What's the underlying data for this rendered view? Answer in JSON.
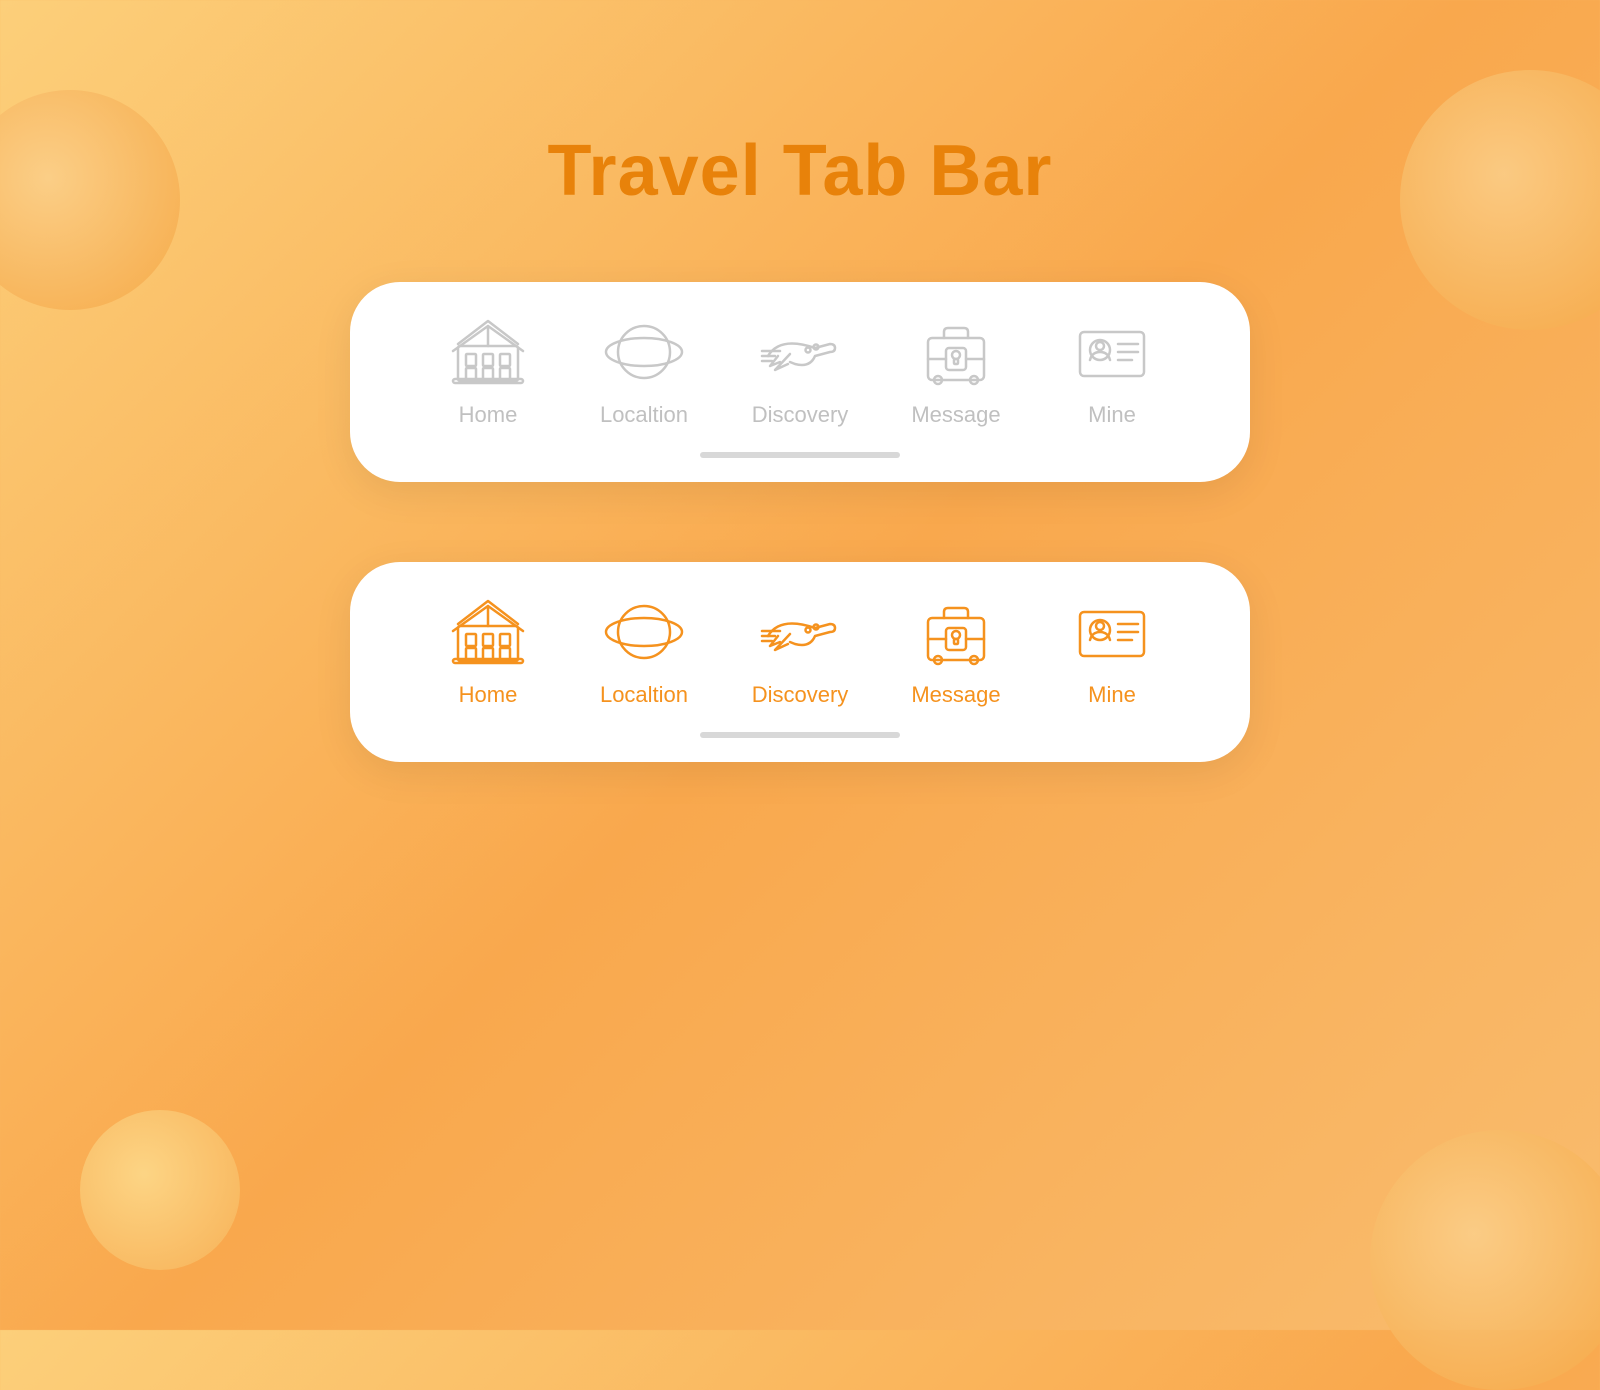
{
  "title": "Travel Tab Bar",
  "tab_bars": [
    {
      "id": "inactive-bar",
      "style": "inactive",
      "tabs": [
        {
          "id": "home",
          "label": "Home"
        },
        {
          "id": "location",
          "label": "Localtion"
        },
        {
          "id": "discovery",
          "label": "Discovery"
        },
        {
          "id": "message",
          "label": "Message"
        },
        {
          "id": "mine",
          "label": "Mine"
        }
      ]
    },
    {
      "id": "active-bar",
      "style": "active",
      "tabs": [
        {
          "id": "home",
          "label": "Home"
        },
        {
          "id": "location",
          "label": "Localtion"
        },
        {
          "id": "discovery",
          "label": "Discovery"
        },
        {
          "id": "message",
          "label": "Message"
        },
        {
          "id": "mine",
          "label": "Mine"
        }
      ]
    }
  ],
  "colors": {
    "active": "#F5921E",
    "inactive": "#C8C8C8",
    "title": "#E8820A"
  }
}
